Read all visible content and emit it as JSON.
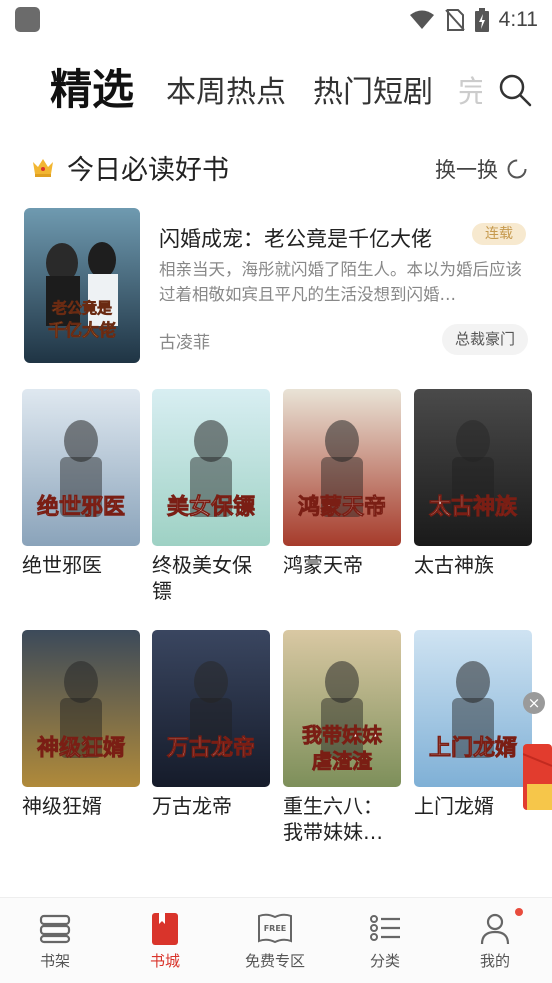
{
  "status_bar": {
    "time": "4:11",
    "icons": [
      "app-icon",
      "wifi-icon",
      "no-sim-icon",
      "battery-charging-icon"
    ]
  },
  "top_tabs": {
    "items": [
      {
        "label": "精选",
        "selected": true
      },
      {
        "label": "本周热点",
        "selected": false
      },
      {
        "label": "热门短剧",
        "selected": false
      }
    ],
    "search_icon": "search-icon"
  },
  "section": {
    "title": "今日必读好书",
    "refresh_label": "换一换",
    "icon": "crown-icon"
  },
  "featured": {
    "title": "闪婚成宠：老公竟是千亿大佬",
    "status_badge": "连载",
    "description": "相亲当天，海彤就闪婚了陌生人。本以为婚后应该过着相敬如宾且平凡的生活没想到闪婚…",
    "author": "古凌菲",
    "genre_tag": "总裁豪门",
    "cover_text": "老公竟是千亿大佬"
  },
  "books": [
    {
      "title": "绝世邪医",
      "cover_text": "绝世邪医",
      "cover_colors": [
        "#dfe8f0",
        "#8aa3ba"
      ]
    },
    {
      "title": "终极美女保镖",
      "cover_text": "美女保镖",
      "cover_colors": [
        "#d8eef2",
        "#9ed1c4"
      ]
    },
    {
      "title": "鸿蒙天帝",
      "cover_text": "鸿蒙天帝",
      "cover_colors": [
        "#e9e3d6",
        "#a63b2b"
      ]
    },
    {
      "title": "太古神族",
      "cover_text": "太古神族",
      "cover_colors": [
        "#4a4a4a",
        "#1a1a1a"
      ]
    },
    {
      "title": "神级狂婿",
      "cover_text": "神级狂婿",
      "cover_colors": [
        "#3c4a5a",
        "#b08a3a"
      ]
    },
    {
      "title": "万古龙帝",
      "cover_text": "万古龙帝",
      "cover_colors": [
        "#3a4660",
        "#151b2a"
      ]
    },
    {
      "title": "重生六八：我带妹妹…",
      "cover_text": "我带妹妹虐渣渣",
      "cover_colors": [
        "#d9c8a3",
        "#7d8f5a"
      ]
    },
    {
      "title": "上门龙婿",
      "cover_text": "上门龙婿",
      "cover_colors": [
        "#cfe3f2",
        "#7fb0d6"
      ]
    }
  ],
  "bottom_nav": {
    "items": [
      {
        "label": "书架",
        "icon": "bookshelf-icon",
        "active": false
      },
      {
        "label": "书城",
        "icon": "bookstore-icon",
        "active": true
      },
      {
        "label": "免费专区",
        "icon": "free-book-icon",
        "active": false,
        "icon_text": "FREE"
      },
      {
        "label": "分类",
        "icon": "category-list-icon",
        "active": false
      },
      {
        "label": "我的",
        "icon": "profile-icon",
        "active": false,
        "badge_dot": true
      }
    ]
  },
  "colors": {
    "accent": "#d9342b",
    "badge_bg": "#f7e9cf",
    "badge_text": "#c69a4e"
  }
}
